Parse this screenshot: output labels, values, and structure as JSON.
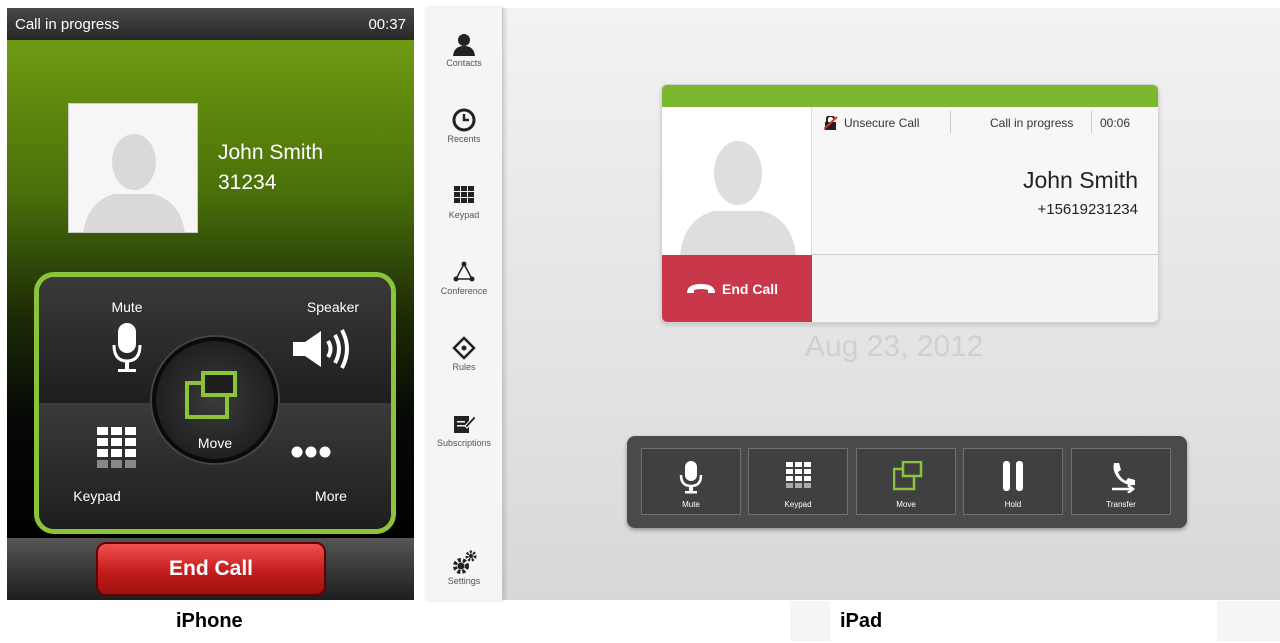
{
  "iphone": {
    "status_title": "Call in progress",
    "status_time": "00:37",
    "contact_name": "John Smith",
    "contact_number": "31234",
    "controls": {
      "mute": "Mute",
      "speaker": "Speaker",
      "move": "Move",
      "keypad": "Keypad",
      "more": "More"
    },
    "end_call": "End Call",
    "caption": "iPhone"
  },
  "ipad": {
    "sidebar": [
      {
        "label": "Contacts",
        "icon": "person-icon"
      },
      {
        "label": "Recents",
        "icon": "clock-icon"
      },
      {
        "label": "Keypad",
        "icon": "keypad-icon"
      },
      {
        "label": "Conference",
        "icon": "conference-icon"
      },
      {
        "label": "Rules",
        "icon": "rules-icon"
      },
      {
        "label": "Subscriptions",
        "icon": "subscriptions-icon"
      },
      {
        "label": "Settings",
        "icon": "gears-icon"
      }
    ],
    "call_card": {
      "security": "Unsecure Call",
      "state": "Call in progress",
      "duration": "00:06",
      "name": "John Smith",
      "number": "+15619231234",
      "end_call": "End Call",
      "date": "Aug 23, 2012"
    },
    "toolbar": {
      "mute": "Mute",
      "keypad": "Keypad",
      "move": "Move",
      "hold": "Hold",
      "transfer": "Transfer"
    },
    "caption": "iPad"
  },
  "colors": {
    "accent_green": "#8bc33a",
    "end_call_red": "#c8374a"
  }
}
